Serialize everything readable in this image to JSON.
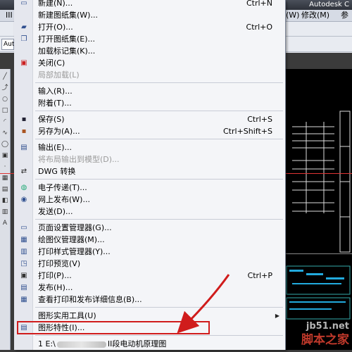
{
  "app_title": "Autodesk C",
  "menubar": {
    "items": [
      "III",
      "(W)",
      "修改(M)",
      "参"
    ]
  },
  "toolbar": {
    "combo_text": "Autc"
  },
  "menu": {
    "items": [
      {
        "icon": "new-icon",
        "label": "新建(N)...",
        "shortcut": "Ctrl+N",
        "disabled": false
      },
      {
        "icon": "",
        "label": "新建图纸集(W)...",
        "shortcut": "",
        "disabled": false
      },
      {
        "icon": "open-icon",
        "label": "打开(O)...",
        "shortcut": "Ctrl+O",
        "disabled": false
      },
      {
        "icon": "open-sheetset-icon",
        "label": "打开图纸集(E)...",
        "shortcut": "",
        "disabled": false
      },
      {
        "icon": "",
        "label": "加载标记集(K)...",
        "shortcut": "",
        "disabled": false
      },
      {
        "icon": "close-icon",
        "label": "关闭(C)",
        "shortcut": "",
        "disabled": false
      },
      {
        "icon": "",
        "label": "局部加载(L)",
        "shortcut": "",
        "disabled": true
      },
      {
        "icon": "",
        "label": "输入(R)...",
        "shortcut": "",
        "disabled": false
      },
      {
        "icon": "",
        "label": "附着(T)...",
        "shortcut": "",
        "disabled": false
      },
      {
        "icon": "save-icon",
        "label": "保存(S)",
        "shortcut": "Ctrl+S",
        "disabled": false
      },
      {
        "icon": "save-as-icon",
        "label": "另存为(A)...",
        "shortcut": "Ctrl+Shift+S",
        "disabled": false
      },
      {
        "icon": "export-icon",
        "label": "输出(E)...",
        "shortcut": "",
        "disabled": false
      },
      {
        "icon": "",
        "label": "将布局输出到模型(D)...",
        "shortcut": "",
        "disabled": true
      },
      {
        "icon": "dwg-convert-icon",
        "label": "DWG 转换",
        "shortcut": "",
        "disabled": false
      },
      {
        "icon": "etransmit-icon",
        "label": "电子传递(T)...",
        "shortcut": "",
        "disabled": false
      },
      {
        "icon": "publish-web-icon",
        "label": "网上发布(W)...",
        "shortcut": "",
        "disabled": false
      },
      {
        "icon": "",
        "label": "发送(D)...",
        "shortcut": "",
        "disabled": false
      },
      {
        "icon": "page-setup-icon",
        "label": "页面设置管理器(G)...",
        "shortcut": "",
        "disabled": false
      },
      {
        "icon": "plotter-icon",
        "label": "绘图仪管理器(M)...",
        "shortcut": "",
        "disabled": false
      },
      {
        "icon": "plot-style-icon",
        "label": "打印样式管理器(Y)...",
        "shortcut": "",
        "disabled": false
      },
      {
        "icon": "plot-preview-icon",
        "label": "打印预览(V)",
        "shortcut": "",
        "disabled": false
      },
      {
        "icon": "print-icon",
        "label": "打印(P)...",
        "shortcut": "Ctrl+P",
        "disabled": false
      },
      {
        "icon": "publish-icon",
        "label": "发布(H)...",
        "shortcut": "",
        "disabled": false
      },
      {
        "icon": "plot-details-icon",
        "label": "查看打印和发布详细信息(B)...",
        "shortcut": "",
        "disabled": false
      },
      {
        "icon": "",
        "label": "图形实用工具(U)",
        "shortcut": "",
        "disabled": false,
        "submenu": true
      },
      {
        "icon": "drawing-properties-icon",
        "label": "图形特性(I)...",
        "shortcut": "",
        "disabled": false
      },
      {
        "icon": "",
        "label": "",
        "shortcut": "",
        "disabled": false
      }
    ],
    "recent": {
      "prefix": "1 E:\\",
      "suffix": "II段电动机原理图"
    }
  },
  "watermark": {
    "url": "jb51.net",
    "name": "脚本之家"
  },
  "colors": {
    "highlight": "#d01c1c",
    "menu_bg": "#f4f5f8"
  }
}
